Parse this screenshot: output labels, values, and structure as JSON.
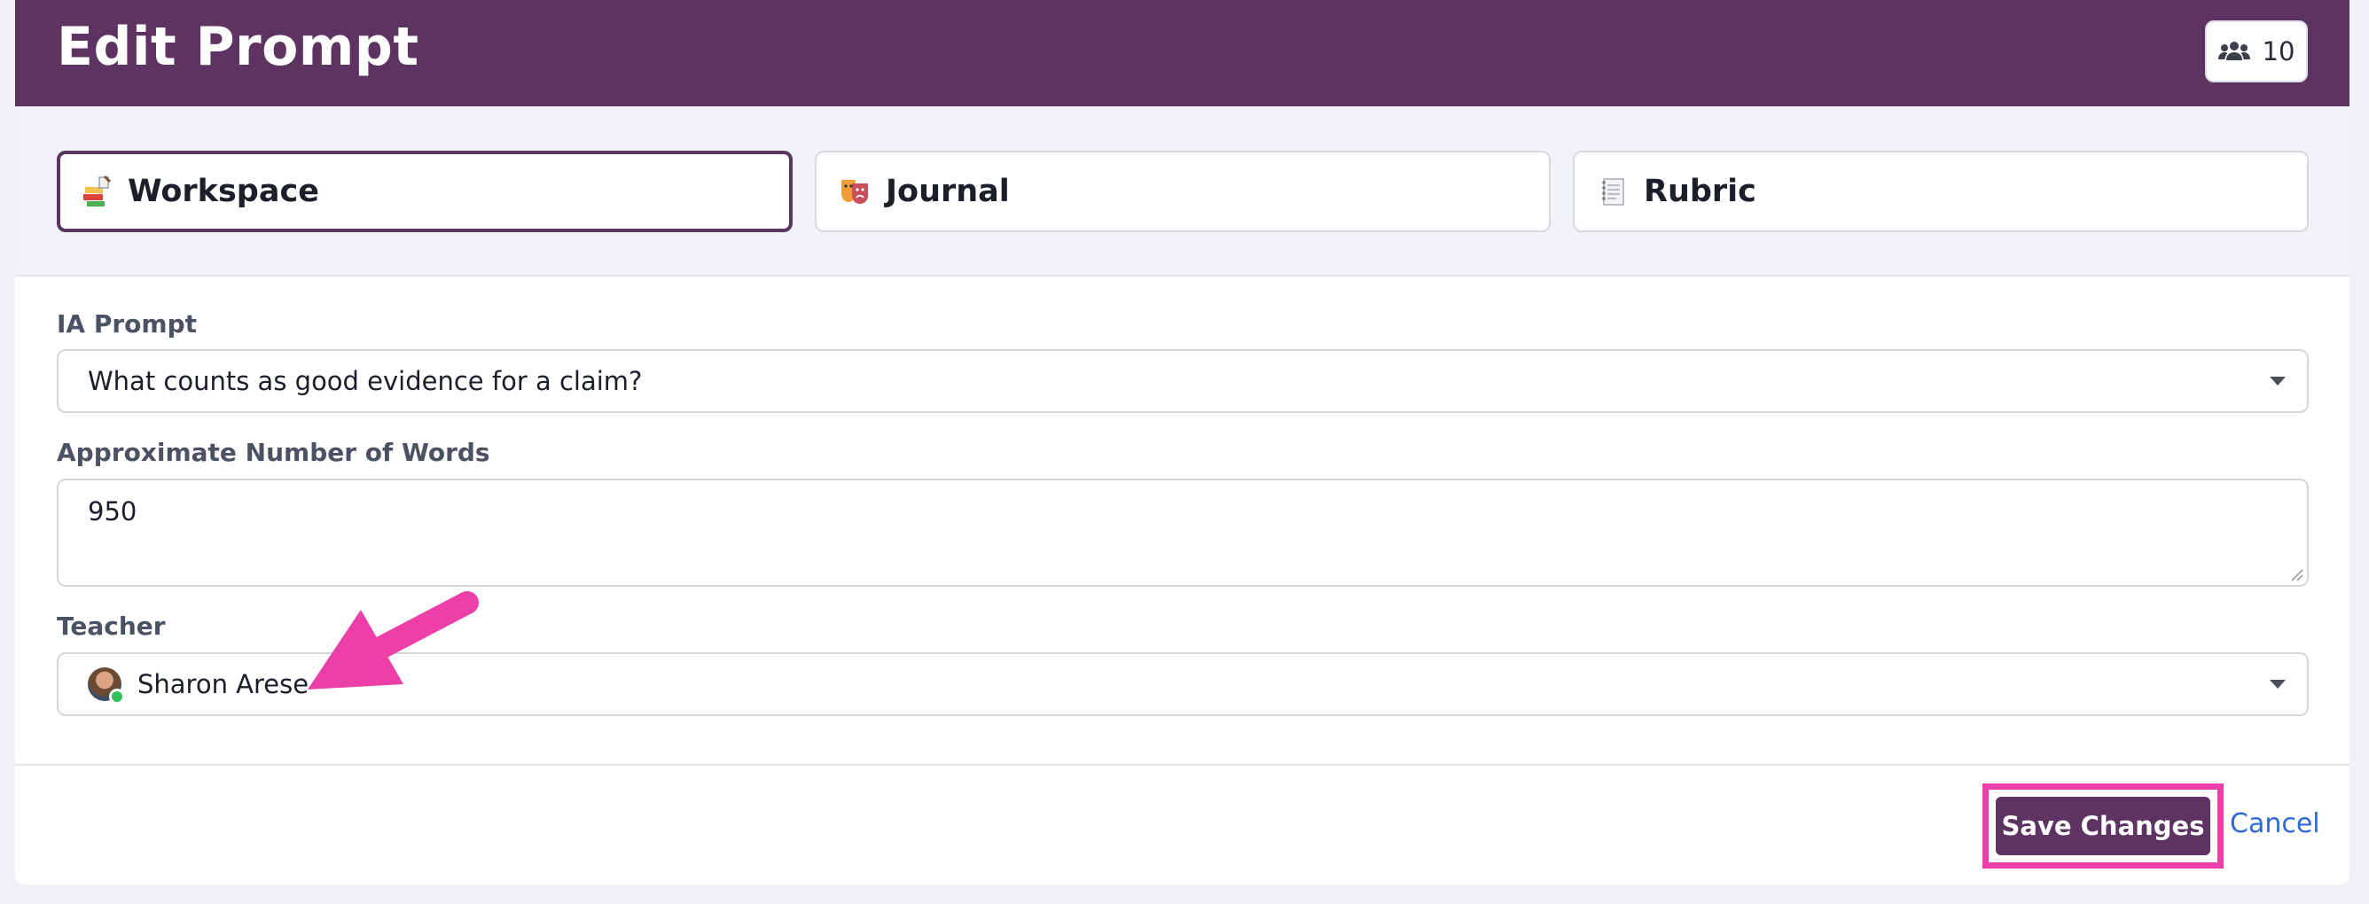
{
  "header": {
    "title": "Edit Prompt",
    "participants_count": "10",
    "participants_icon": "users-icon"
  },
  "tabs": [
    {
      "label": "Workspace",
      "icon": "workspace-icon",
      "active": true
    },
    {
      "label": "Journal",
      "icon": "journal-icon",
      "active": false
    },
    {
      "label": "Rubric",
      "icon": "rubric-icon",
      "active": false
    }
  ],
  "form": {
    "prompt": {
      "label": "IA Prompt",
      "value": "What counts as good evidence for a claim?"
    },
    "words": {
      "label": "Approximate Number of Words",
      "value": "950"
    },
    "teacher": {
      "label": "Teacher",
      "value": "Sharon Arese"
    }
  },
  "footer": {
    "save_label": "Save Changes",
    "cancel_label": "Cancel"
  },
  "colors": {
    "brand": "#5d3461",
    "highlight": "#ec3fa8",
    "link": "#2e6bd6",
    "online": "#2fbf5b"
  }
}
